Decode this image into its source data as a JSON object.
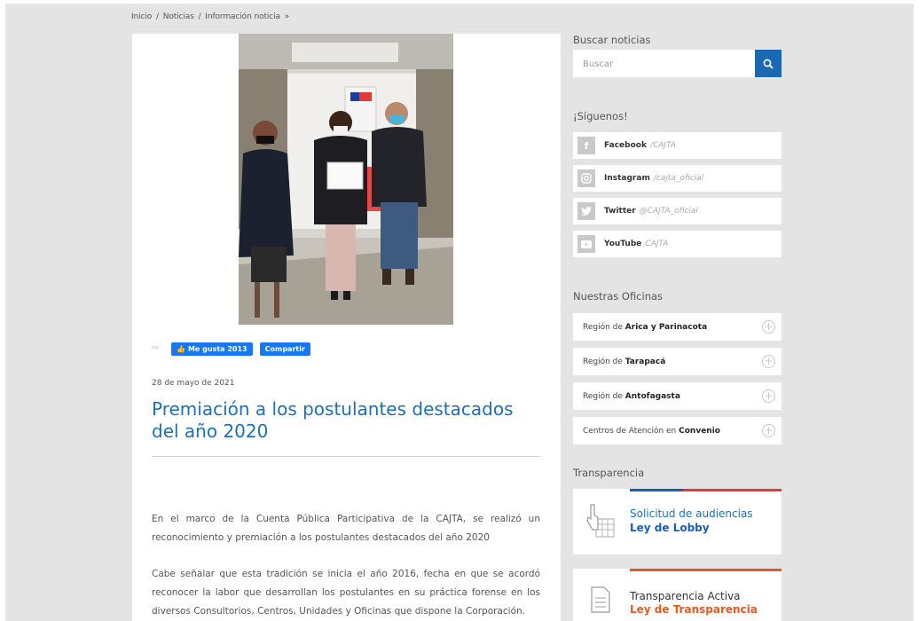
{
  "breadcrumb": {
    "home": "Inicio",
    "sep1": "/",
    "news": "Noticias",
    "sep2": "/",
    "current": "Información noticia",
    "arrow": "»"
  },
  "article": {
    "like_label": "Me gusta 2013",
    "share_label": "Compartir",
    "date": "28 de mayo de 2021",
    "title": "Premiación a los postulantes destacados del año 2020",
    "paragraph1": "En el marco de la Cuenta Pública Participativa de la CAJTA, se realizó un reconocimiento y premiación a los postulantes destacados del año 2020",
    "paragraph2": "Cabe señalar que esta tradición se inicia el año 2016, fecha en que se acordó reconocer la labor que desarrollan los postulantes en su práctica forense en los diversos Consultorios, Centros, Unidades y Oficinas que dispone la Corporación."
  },
  "sidebar": {
    "search_heading": "Buscar noticias",
    "search_placeholder": "Buscar",
    "follow_heading": "¡Síguenos!",
    "social": [
      {
        "name": "Facebook",
        "handle": "/CAJTA",
        "icon": "facebook-icon"
      },
      {
        "name": "Instagram",
        "handle": "/cajta_oficial",
        "icon": "instagram-icon"
      },
      {
        "name": "Twitter",
        "handle": "@CAJTA_oficial",
        "icon": "twitter-icon"
      },
      {
        "name": "YouTube",
        "handle": "CAJTA",
        "icon": "youtube-icon"
      }
    ],
    "offices_heading": "Nuestras Oficinas",
    "offices": [
      {
        "prefix": "Región de",
        "name": "Arica y Parinacota"
      },
      {
        "prefix": "Región de",
        "name": "Tarapacá"
      },
      {
        "prefix": "Región de",
        "name": "Antofagasta"
      },
      {
        "prefix": "Centros de Atención en",
        "name": "Convenio"
      }
    ],
    "transparency_heading": "Transparencia",
    "transparency": [
      {
        "line1": "Solicitud de audiencias",
        "line2": "Ley de Lobby",
        "line2_color": "#1a5fb4"
      },
      {
        "line1": "Transparencia Activa",
        "line2": "Ley de Transparencia",
        "line2_color": "#e65a1f"
      }
    ]
  },
  "colors": {
    "accent_blue": "#1a69b5",
    "facebook_blue": "#1877f2",
    "title_blue": "#1f6fb5",
    "red": "#e53935"
  }
}
